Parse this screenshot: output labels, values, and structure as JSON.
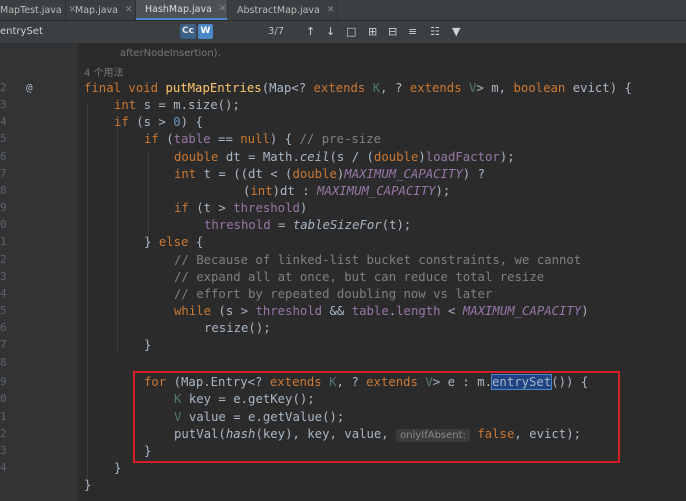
{
  "tabs": [
    {
      "label": "MapTest.java",
      "icon_color": "#6a8759"
    },
    {
      "label": "Map.java",
      "icon_color": "#62b543"
    },
    {
      "label": "HashMap.java",
      "icon_color": "#3592c4",
      "active": true
    },
    {
      "label": "AbstractMap.java",
      "icon_color": "#3592c4"
    }
  ],
  "search": {
    "query": "entrySet",
    "match_case": "Cc",
    "words": "W",
    "count": "3/7"
  },
  "gutter_numbers": [
    "",
    "2",
    "3",
    "4",
    "5",
    "6",
    "7",
    "8",
    "9",
    "0",
    "1",
    "2",
    "3",
    "4",
    "5",
    "6",
    "7",
    "8",
    "9",
    "0",
    "1",
    "2",
    "3",
    "4"
  ],
  "usages": "4 个用法",
  "code": {
    "prev_line": "afterNodeInsertion).",
    "method_name": "putMapEntries",
    "loop_method": "entrySet",
    "inlay_hint": "onlyIfAbsent:"
  }
}
